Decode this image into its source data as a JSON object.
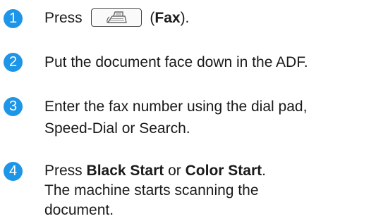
{
  "steps": [
    {
      "number": "1",
      "press": "Press",
      "open_paren": "(",
      "key_label": "Fax",
      "close_paren": ")."
    },
    {
      "number": "2",
      "text": "Put the document face down in the ADF."
    },
    {
      "number": "3",
      "line1": "Enter the fax number using the dial pad,",
      "line2": "Speed-Dial or Search."
    },
    {
      "number": "4",
      "press": "Press",
      "button1": "Black Start",
      "or": "or",
      "button2": "Color Start",
      "period": ".",
      "line2": "The machine starts scanning the",
      "line3": "document."
    }
  ],
  "colors": {
    "badge": "#1e96e8"
  },
  "icons": {
    "fax_key": "fax-machine-icon"
  }
}
